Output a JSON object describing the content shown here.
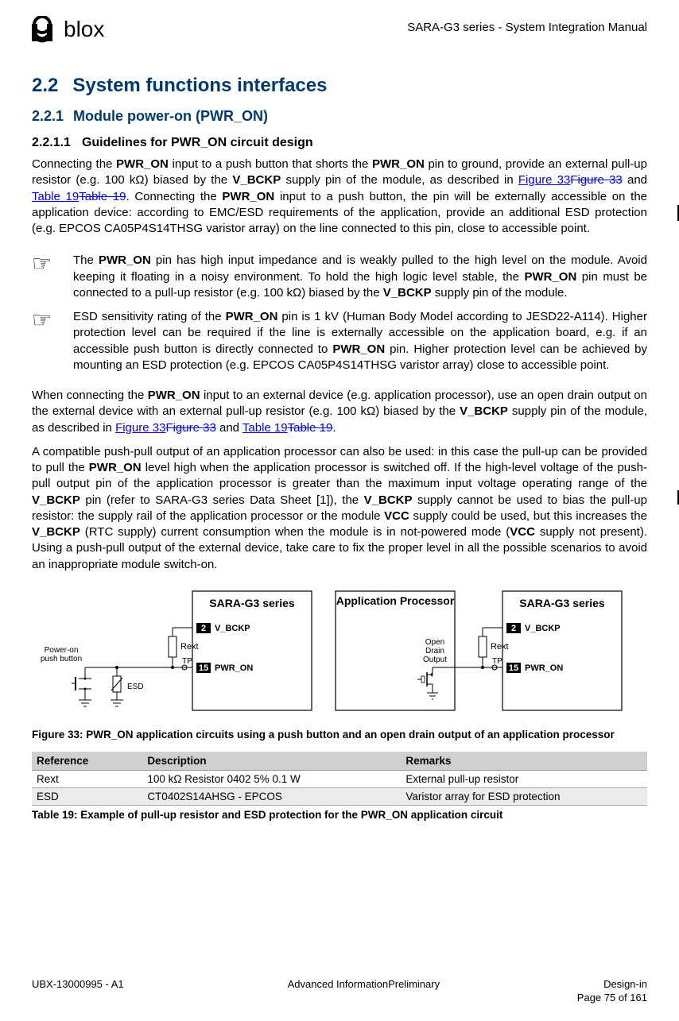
{
  "header": {
    "logo_text": "blox",
    "doc_title": "SARA-G3 series - System Integration Manual"
  },
  "h2": {
    "num": "2.2",
    "title": "System functions interfaces"
  },
  "h3": {
    "num": "2.2.1",
    "title": "Module power-on (PWR_ON)"
  },
  "h4": {
    "num": "2.2.1.1",
    "title": "Guidelines for PWR_ON circuit design"
  },
  "p1": {
    "t1": "Connecting the ",
    "b1": "PWR_ON",
    "t2": " input to a push button that shorts the ",
    "b2": "PWR_ON",
    "t3": " pin to ground, provide an external pull-up resistor (e.g. 100 kΩ) biased by the ",
    "b3": "V_BCKP",
    "t4": " supply pin of the module, as described in ",
    "l1a": "Figure 33",
    "l1b": "Figure 33",
    "t5": " and ",
    "l2a": "Table 19",
    "l2b": "Table 19",
    "t6": ". Connecting the ",
    "b4": "PWR_ON",
    "t7": " input to a push button, the pin will be externally accessible on the application device: according to EMC/ESD requirements of the application, provide an additional ESD protection (e.g. EPCOS CA05P4S14THSG varistor array) on the line connected to this pin, close to accessible point."
  },
  "note1": {
    "t1": "The ",
    "b1": "PWR_ON",
    "t2": " pin has high input impedance and is weakly pulled to the high level on the module. Avoid keeping it floating in a noisy environment. To hold the high logic level stable, the ",
    "b2": "PWR_ON",
    "t3": " pin must be connected to a pull-up resistor (e.g. 100 kΩ) biased by the ",
    "b3": "V_BCKP",
    "t4": " supply pin of the module."
  },
  "note2": {
    "t1": "ESD sensitivity rating of the ",
    "b1": "PWR_ON",
    "t2": " pin is 1 kV (Human Body Model according to JESD22-A114). Higher protection level can be required if the line is externally accessible on the application board, e.g. if an accessible push button is directly connected to ",
    "b2": "PWR_ON",
    "t3": " pin. Higher protection level can be achieved by mounting an ESD protection (e.g. EPCOS CA05P4S14THSG varistor array) close to accessible point."
  },
  "p2": {
    "t1": "When connecting the ",
    "b1": "PWR_ON",
    "t2": " input to an external device (e.g. application processor), use an open drain output on the external device with an external pull-up resistor (e.g. 100 kΩ) biased by the ",
    "b2": "V_BCKP",
    "t3": " supply pin of the module, as described in ",
    "l1a": "Figure 33",
    "l1b": "Figure 33",
    "t4": " and ",
    "l2a": "Table 19",
    "l2b": "Table 19",
    "t5": "."
  },
  "p3": {
    "t1": "A compatible push-pull output of an application processor can also be used: in this case the pull-up can be provided to pull the ",
    "b1": "PWR_ON",
    "t2": " level high when the application processor is switched off. If the high-level voltage of the push-pull output pin of the application processor is greater than the maximum input voltage operating range of the ",
    "b2": "V_BCKP",
    "t3": " pin (refer to SARA-G3 series Data Sheet [1]), the ",
    "b3": "V_BCKP",
    "t4": " supply cannot be used to bias the pull-up resistor: the supply rail of the application processor or the module ",
    "b4": "VCC",
    "t5": " supply could be used, but this increases the ",
    "b5": "V_BCKP",
    "t6": " (RTC supply) current consumption when the module is in not-powered mode (",
    "b6": "VCC",
    "t7": " supply not present). Using a push-pull output of the external device, take care to fix the proper level in all the possible scenarios to avoid an inappropriate module switch-on."
  },
  "figure": {
    "left_title": "SARA-G3 series",
    "mid_title": "Application Processor",
    "right_title": "SARA-G3 series",
    "pin2": "2",
    "pin15": "15",
    "vbckp": "V_BCKP",
    "pwron": "PWR_ON",
    "rext": "Rext",
    "tp": "TP",
    "esd": "ESD",
    "btn1": "Power-on",
    "btn2": "push button",
    "od1": "Open",
    "od2": "Drain",
    "od3": "Output"
  },
  "fig_caption": "Figure 33: PWR_ON application circuits using a push button and an open drain output of an application processor",
  "table": {
    "headers": [
      "Reference",
      "Description",
      "Remarks"
    ],
    "rows": [
      [
        "Rext",
        "100 kΩ Resistor 0402 5% 0.1 W",
        "External pull-up resistor"
      ],
      [
        "ESD",
        "CT0402S14AHSG - EPCOS",
        "Varistor array for ESD protection"
      ]
    ]
  },
  "tbl_caption": "Table 19: Example of pull-up resistor and ESD protection for the PWR_ON application circuit",
  "footer": {
    "left": "UBX-13000995 - A1",
    "center": "Advanced InformationPreliminary",
    "right": "Design-in",
    "page": "Page 75 of 161"
  }
}
